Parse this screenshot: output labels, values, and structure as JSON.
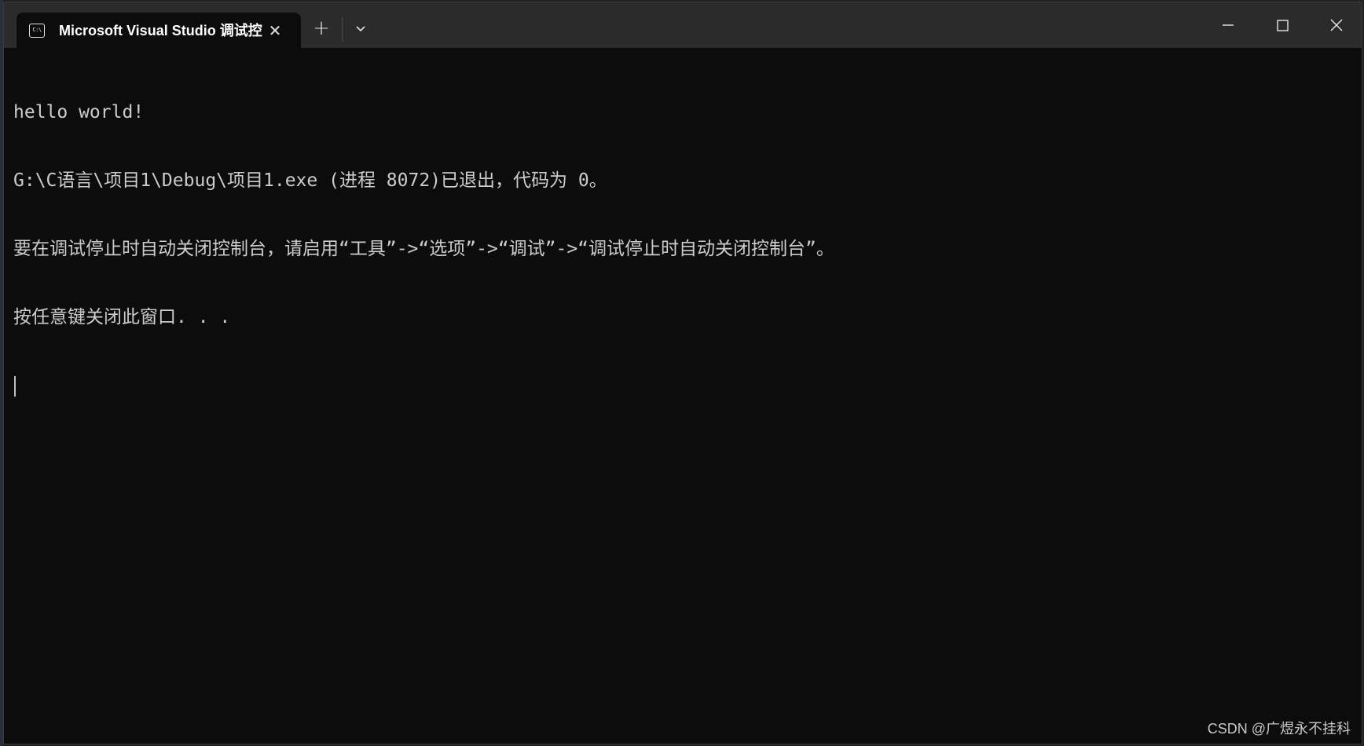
{
  "window": {
    "tab_title": "Microsoft Visual Studio 调试控",
    "tab_icon": "console-app-icon",
    "tab_icon_text": "C:\\",
    "close_tab_glyph": "✕",
    "new_tab_glyph": "+",
    "dropdown_icon": "chevron-down-icon",
    "controls": {
      "minimize_icon": "minimize-icon",
      "maximize_icon": "maximize-icon",
      "close_icon": "close-icon"
    },
    "colors": {
      "background": "#0c0c0c",
      "titlebar": "#2b2b2b",
      "text": "#cccccc"
    }
  },
  "console": {
    "lines": [
      "hello world!",
      "G:\\C语言\\项目1\\Debug\\项目1.exe (进程 8072)已退出，代码为 0。",
      "要在调试停止时自动关闭控制台，请启用“工具”->“选项”->“调试”->“调试停止时自动关闭控制台”。",
      "按任意键关闭此窗口. . ."
    ]
  },
  "watermark": "CSDN @广煜永不挂科"
}
